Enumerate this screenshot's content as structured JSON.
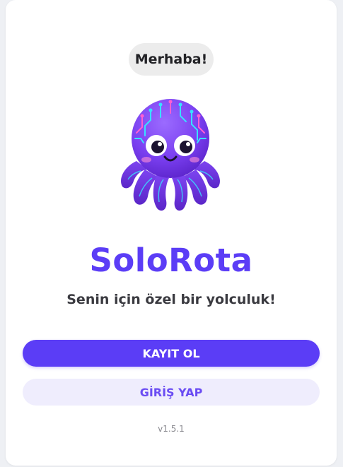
{
  "greeting": "Merhaba!",
  "app_name": "SoloRota",
  "tagline": "Senin için özel bir yolculuk!",
  "buttons": {
    "register": "KAYIT OL",
    "login": "GİRİŞ YAP"
  },
  "version": "v1.5.1",
  "icons": {
    "mascot": "octopus-mascot-icon"
  },
  "colors": {
    "brand": "#5b3df6",
    "secondary_button_bg": "#efedfd",
    "background": "#ffffff"
  }
}
